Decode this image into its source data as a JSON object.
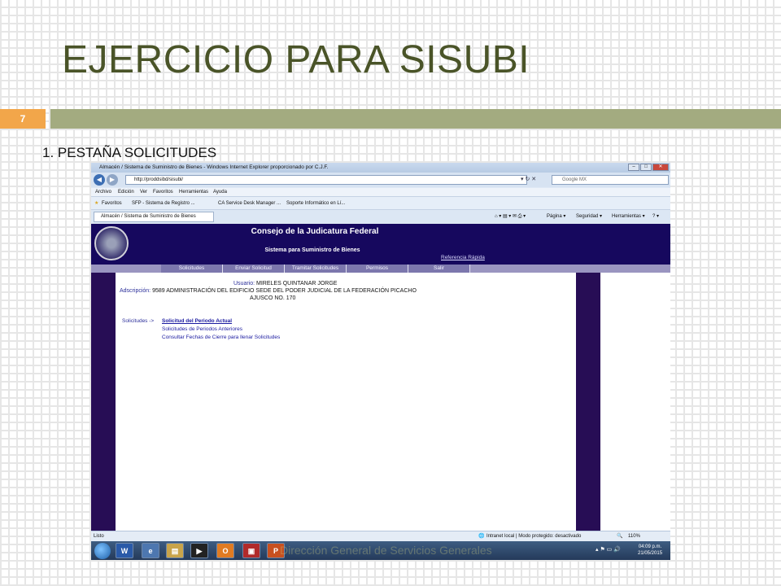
{
  "slide": {
    "title": "EJERCICIO PARA SISUBI",
    "slide_number": "7",
    "subtitle": "1. PESTAÑA SOLICITUDES"
  },
  "browser": {
    "window_title": "Almacén / Sistema de Suministro de Bienes - Windows Internet Explorer proporcionado por C.J.F.",
    "address": "http://proddsibd/sisubi/",
    "search_placeholder": "Google MX",
    "menu": [
      "Archivo",
      "Edición",
      "Ver",
      "Favoritos",
      "Herramientas",
      "Ayuda"
    ],
    "favorites_label": "Favoritos",
    "favorites": [
      "SFP - Sistema de Registro ...",
      "CA Service Desk Manager ...",
      "Soporte Informático en Lí..."
    ],
    "tab_label": "Almacén / Sistema de Suministro de Bienes",
    "commands": [
      "Página ▾",
      "Seguridad ▾",
      "Herramientas ▾"
    ],
    "status_left": "Listo",
    "status_zone": "Intranet local | Modo protegido: desactivado",
    "zoom": "110%"
  },
  "page": {
    "org_name": "Consejo de la Judicatura Federal",
    "system_name": "Sistema para Suministro de Bienes",
    "quick_ref": "Referencia Rápida",
    "nav_tabs": [
      "Solicitudes",
      "Enviar Solicitud",
      "Tramitar Solicitudes",
      "Permisos",
      "Salir"
    ],
    "user_label": "Usuario:",
    "user_name": "MIRELES QUINTANAR JORGE",
    "adscription_label": "Adscripción:",
    "adscription_value": "9589 ADMINISTRACIÓN DEL EDIFICIO SEDE DEL PODER JUDICIAL DE LA FEDERACIÓN PICACHO",
    "adscription_line2": "AJUSCO NO. 170",
    "solicitudes_label": "Solicitudes ->",
    "links": [
      "Solicitud del Periodo Actual",
      "Solicitudes de Periodos Anteriores",
      "Consultar Fechas de Cierre para llenar Solicitudes"
    ]
  },
  "taskbar": {
    "overlay_text": "Dirección General de Servicios Generales",
    "time": "04:09 p.m.",
    "date": "21/05/2015"
  }
}
